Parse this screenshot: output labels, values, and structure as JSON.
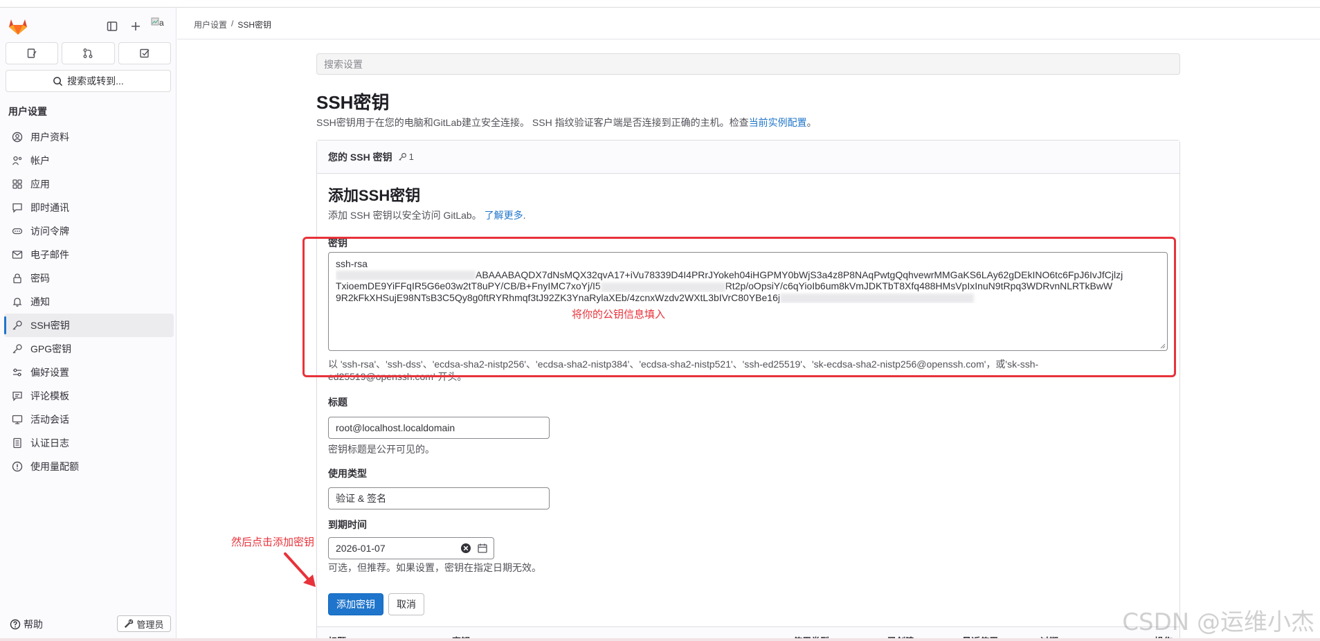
{
  "sidebar": {
    "avatar_alt": "a",
    "search_label": "搜索或转到...",
    "section_title": "用户设置",
    "items": [
      {
        "label": "用户资料",
        "icon": "profile-icon"
      },
      {
        "label": "帐户",
        "icon": "account-icon"
      },
      {
        "label": "应用",
        "icon": "applications-icon"
      },
      {
        "label": "即时通讯",
        "icon": "chat-icon"
      },
      {
        "label": "访问令牌",
        "icon": "token-icon"
      },
      {
        "label": "电子邮件",
        "icon": "mail-icon"
      },
      {
        "label": "密码",
        "icon": "lock-icon"
      },
      {
        "label": "通知",
        "icon": "bell-icon"
      },
      {
        "label": "SSH密钥",
        "icon": "key-icon",
        "active": true
      },
      {
        "label": "GPG密钥",
        "icon": "key-icon"
      },
      {
        "label": "偏好设置",
        "icon": "preferences-icon"
      },
      {
        "label": "评论模板",
        "icon": "comment-icon"
      },
      {
        "label": "活动会话",
        "icon": "monitor-icon"
      },
      {
        "label": "认证日志",
        "icon": "log-icon"
      },
      {
        "label": "使用量配额",
        "icon": "quota-icon"
      }
    ],
    "help_label": "帮助",
    "admin_label": "管理员"
  },
  "breadcrumb": {
    "parent": "用户设置",
    "separator": "/",
    "current": "SSH密钥"
  },
  "settings_search": {
    "placeholder": "搜索设置"
  },
  "page": {
    "title": "SSH密钥",
    "description": "SSH密钥用于在您的电脑和GitLab建立安全连接。 SSH 指纹验证客户端是否连接到正确的主机。检查",
    "description_link": "当前实例配置",
    "description_end": "。"
  },
  "card": {
    "header": "您的 SSH 密钥",
    "count": "1"
  },
  "form": {
    "title": "添加SSH密钥",
    "desc_prefix": "添加 SSH 密钥以安全访问 GitLab。",
    "desc_link": "了解更多",
    "desc_suffix": ".",
    "key_label": "密钥",
    "key_value": {
      "line1": "ssh-rsa",
      "line2_visible": "ABAAABAQDX7dNsMQX32qvA17+iVu78339D4I4PRrJYokeh04iHGPMY0bWjS3a4z8P8NAqPwtgQqhvewrMMGaKS6LAy62gDEkINO6tc6FpJ6IvJfCjlzj",
      "line3_a": "TxioemDE9YiFFqIR5G6e03w2tT8uPY/CB/B+FnyIMC7xoYj/I5",
      "line3_b": "Rt2p/oOpsiY/c6qYioIb6um8kVmJDKTbT8Xfq488HMsVpIxInuN9tRpq3WDRvnNLRTkBwW",
      "line4": "9R2kFkXHSujE98NTsB3C5Qy8g0ftRYRhmqf3tJ92ZK3YnaRylaXEb/4zcnxWzdv2WXtL3bIVrC80YBe16j"
    },
    "key_help": "以 'ssh-rsa'、'ssh-dss'、'ecdsa-sha2-nistp256'、'ecdsa-sha2-nistp384'、'ecdsa-sha2-nistp521'、'ssh-ed25519'、'sk-ecdsa-sha2-nistp256@openssh.com'，或'sk-ssh-",
    "key_help_line2": "ed25519@openssh.com' 开头。",
    "title_label": "标题",
    "title_value": "root@localhost.localdomain",
    "title_help": "密钥标题是公开可见的。",
    "usage_label": "使用类型",
    "usage_value": "验证 & 签名",
    "expiry_label": "到期时间",
    "expiry_value": "2026-01-07",
    "expiry_help": "可选，但推荐。如果设置，密钥在指定日期无效。",
    "submit_label": "添加密钥",
    "cancel_label": "取消"
  },
  "table_headers": [
    "标题",
    "密钥",
    "使用类型",
    "已创建",
    "最近使用",
    "过期",
    "操作"
  ],
  "annotations": {
    "fill_hint": "将你的公钥信息填入",
    "click_hint": "然后点击添加密钥",
    "color": "#e8323a"
  },
  "watermark": "CSDN @运维小杰",
  "colors": {
    "accent": "#1f75cb",
    "annotation": "#e8323a"
  }
}
